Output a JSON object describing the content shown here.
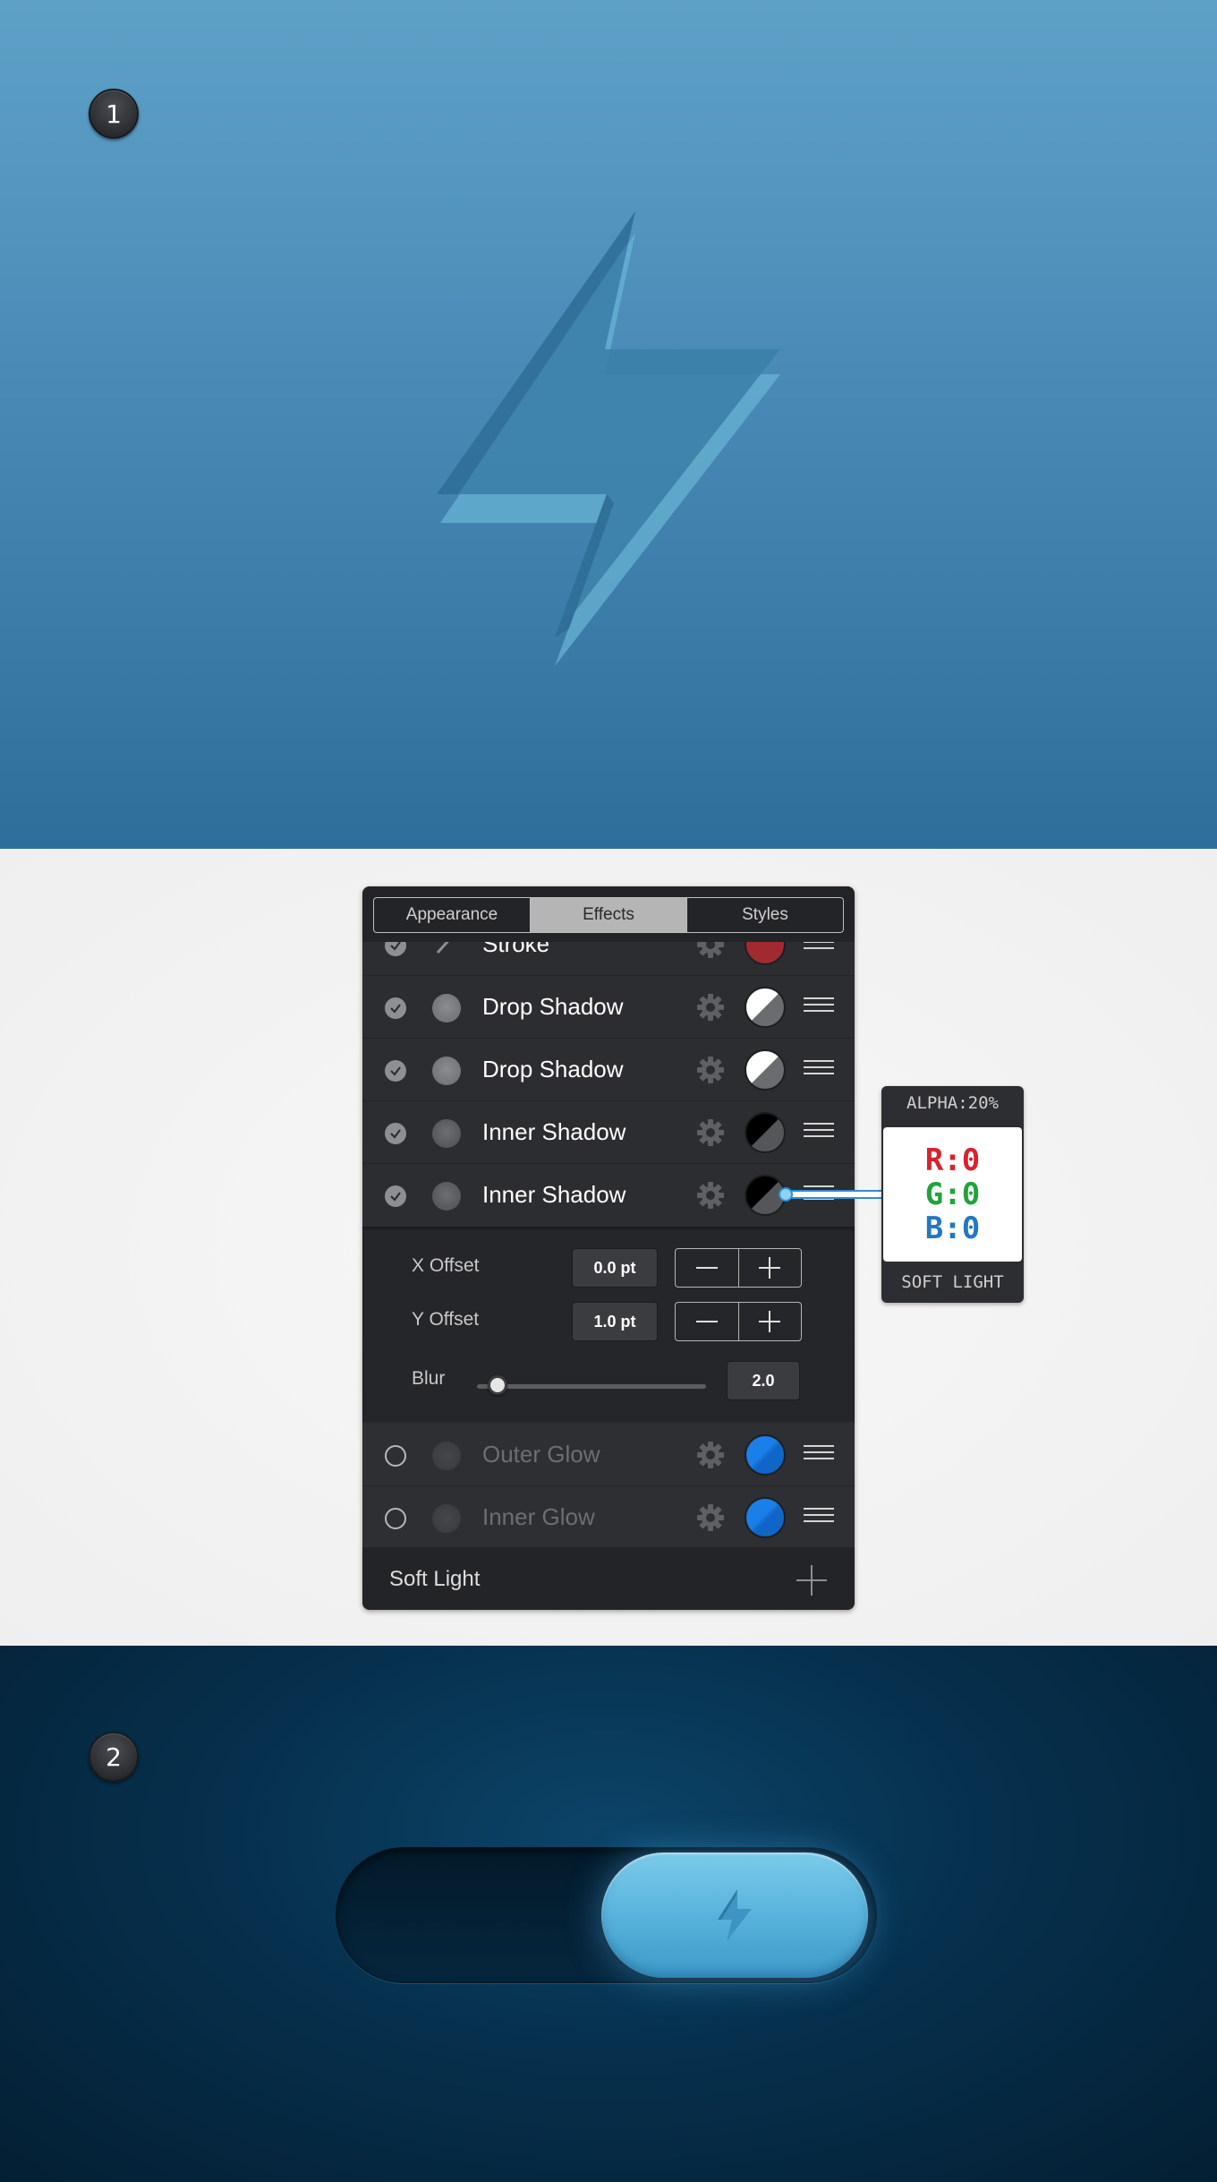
{
  "steps": {
    "first": "1",
    "second": "2"
  },
  "panel": {
    "tabs": [
      "Appearance",
      "Effects",
      "Styles"
    ],
    "active_tab": "Effects",
    "rows": [
      {
        "label": "Stroke",
        "enabled": true
      },
      {
        "label": "Drop Shadow",
        "enabled": true
      },
      {
        "label": "Drop Shadow",
        "enabled": true
      },
      {
        "label": "Inner Shadow",
        "enabled": true
      },
      {
        "label": "Inner Shadow",
        "enabled": true
      },
      {
        "label": "Outer Glow",
        "enabled": false
      },
      {
        "label": "Inner Glow",
        "enabled": false
      }
    ],
    "detail": {
      "x_offset_label": "X Offset",
      "x_offset_value": "0.0 pt",
      "y_offset_label": "Y Offset",
      "y_offset_value": "1.0 pt",
      "blur_label": "Blur",
      "blur_value": "2.0",
      "blur_slider_fraction": 0.05
    },
    "footer": {
      "blend_mode": "Soft Light"
    }
  },
  "callout": {
    "alpha": "ALPHA:20%",
    "r": "R:0",
    "g": "G:0",
    "b": "B:0",
    "blend": "SOFT LIGHT"
  },
  "colors": {
    "r_text": "#d9232e",
    "g_text": "#22a33b",
    "b_text": "#2477c0",
    "glow_swatch": "#1a7fe8"
  }
}
